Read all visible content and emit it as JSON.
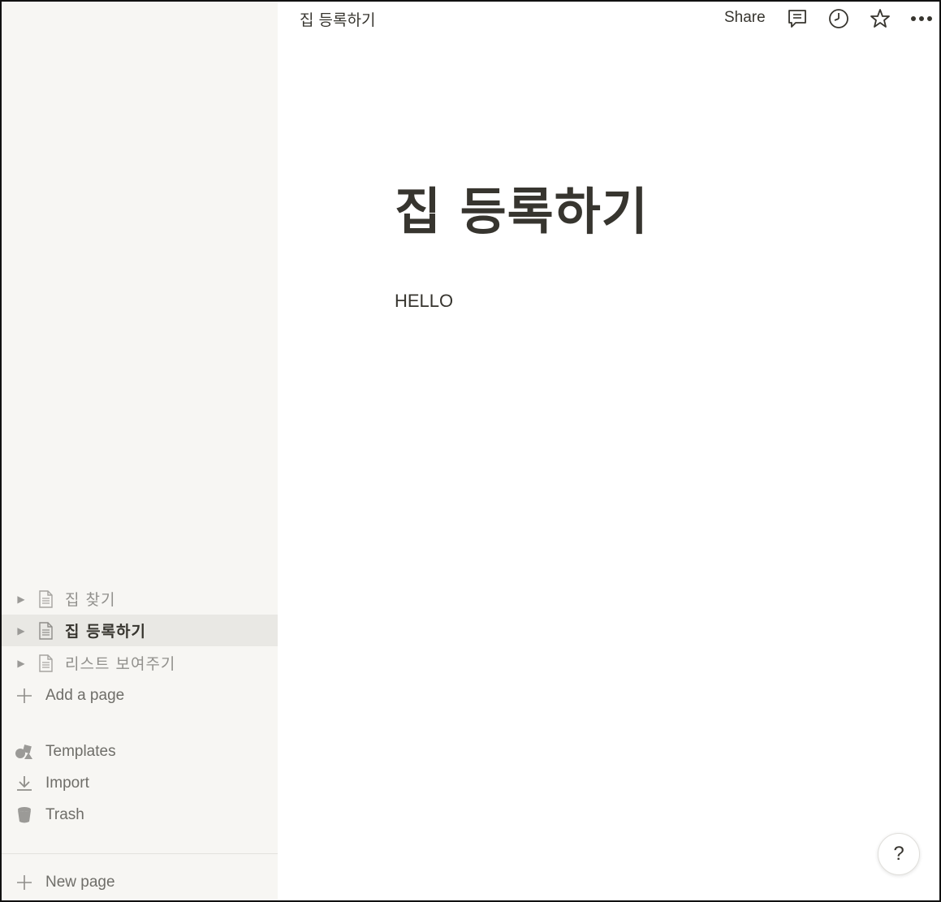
{
  "topbar": {
    "breadcrumb": "집 등록하기",
    "share_label": "Share",
    "icons": [
      "comment-icon",
      "clock-icon",
      "star-icon",
      "more-icon"
    ]
  },
  "sidebar": {
    "pages": [
      {
        "label": "집 찾기",
        "active": false
      },
      {
        "label": "집 등록하기",
        "active": true
      },
      {
        "label": "리스트 보여주기",
        "active": false
      }
    ],
    "add_page_label": "Add a page",
    "templates_label": "Templates",
    "import_label": "Import",
    "trash_label": "Trash",
    "new_page_label": "New page"
  },
  "main": {
    "title": "집 등록하기",
    "body_text": "HELLO"
  },
  "help": {
    "label": "?"
  },
  "colors": {
    "sidebar_bg": "#f7f6f3",
    "active_item_bg": "#e9e8e4",
    "text_primary": "#37352f",
    "text_muted": "#91908c"
  }
}
